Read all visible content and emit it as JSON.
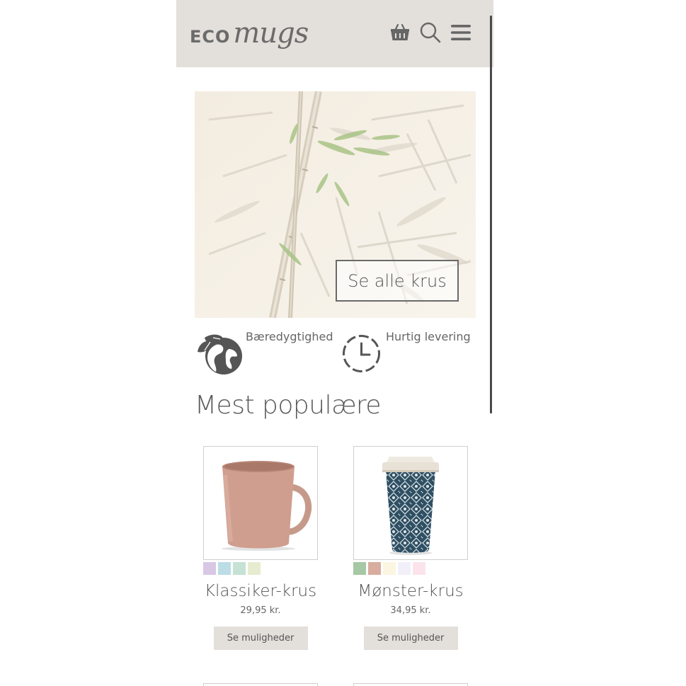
{
  "header": {
    "logo_eco": "ECO",
    "logo_mugs": "mugs",
    "icons": [
      "basket-icon",
      "search-icon",
      "menu-icon"
    ]
  },
  "hero": {
    "button_label": "Se alle krus"
  },
  "features": [
    {
      "icon": "globe-leaf-icon",
      "label": "Bæredygtighed"
    },
    {
      "icon": "clock-icon",
      "label": "Hurtig levering"
    }
  ],
  "popular": {
    "title": "Mest populære",
    "products": [
      {
        "name": "Klassiker-krus",
        "price": "29,95 kr.",
        "button_label": "Se muligheder",
        "swatches": [
          "#d8c8e6",
          "#bcdde6",
          "#c5e2d4",
          "#e6eccf"
        ]
      },
      {
        "name": "Mønster-krus",
        "price": "34,95 kr.",
        "button_label": "Se muligheder",
        "swatches": [
          "#a6c8a4",
          "#d9aca0",
          "#fbf6e1",
          "#f1f0f8",
          "#fbe3ec"
        ]
      }
    ]
  },
  "colors": {
    "header_bg": "#e3dfda",
    "button_bg": "#e3dfda",
    "text": "#555555"
  }
}
